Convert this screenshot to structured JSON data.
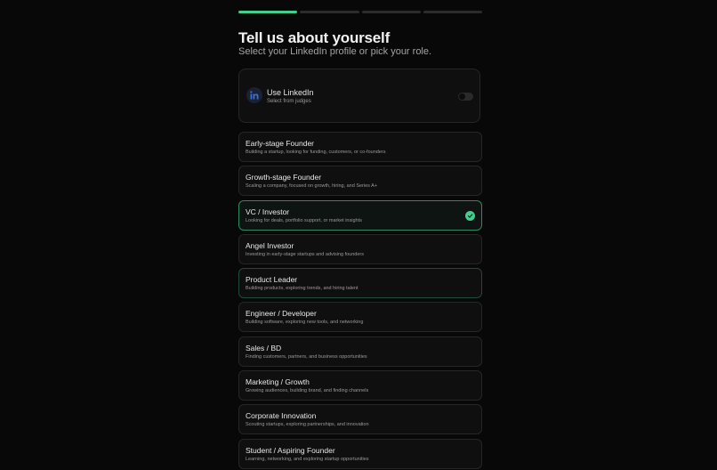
{
  "progress": {
    "total_steps": 4,
    "current_step": 1
  },
  "header": {
    "title": "Tell us about yourself",
    "subtitle": "Select your LinkedIn profile or pick your role."
  },
  "linkedin": {
    "title": "Use LinkedIn",
    "subtitle": "Select from judges",
    "icon": "linkedin-icon",
    "toggle_on": false
  },
  "roles": [
    {
      "title": "Early-stage Founder",
      "description": "Building a startup, looking for funding, customers, or co-founders",
      "selected": false
    },
    {
      "title": "Growth-stage Founder",
      "description": "Scaling a company, focused on growth, hiring, and Series A+",
      "selected": false
    },
    {
      "title": "VC / Investor",
      "description": "Looking for deals, portfolio support, or market insights",
      "selected": true
    },
    {
      "title": "Angel Investor",
      "description": "Investing in early-stage startups and advising founders",
      "selected": false
    },
    {
      "title": "Product Leader",
      "description": "Building products, exploring trends, and hiring talent",
      "selected": false
    },
    {
      "title": "Engineer / Developer",
      "description": "Building software, exploring new tools, and networking",
      "selected": false
    },
    {
      "title": "Sales / BD",
      "description": "Finding customers, partners, and business opportunities",
      "selected": false
    },
    {
      "title": "Marketing / Growth",
      "description": "Growing audiences, building brand, and finding channels",
      "selected": false
    },
    {
      "title": "Corporate Innovation",
      "description": "Scouting startups, exploring partnerships, and innovation",
      "selected": false
    },
    {
      "title": "Student / Aspiring Founder",
      "description": "Learning, networking, and exploring startup opportunities",
      "selected": false
    }
  ],
  "colors": {
    "accent": "#3fcf8e",
    "background": "#080808",
    "card": "#0f0f0f",
    "linkedin_blue": "#3b6fd8"
  }
}
